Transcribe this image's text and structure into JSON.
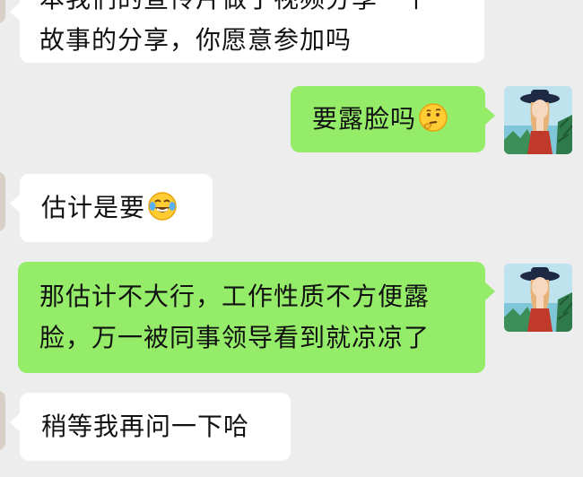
{
  "messages": [
    {
      "id": "m1",
      "direction": "incoming",
      "lines": [
        "本我们的宣传片做了视频分享一个",
        "故事的分享，你愿意参加吗"
      ]
    },
    {
      "id": "m2",
      "direction": "outgoing",
      "text": "要露脸吗",
      "emoji": "thinking-face-icon"
    },
    {
      "id": "m3",
      "direction": "incoming",
      "text": "估计是要",
      "emoji": "tears-of-joy-icon"
    },
    {
      "id": "m4",
      "direction": "outgoing",
      "lines": [
        "那估计不大行，工作性质不方便露",
        "脸，万一被同事领导看到就凉凉了"
      ]
    },
    {
      "id": "m5",
      "direction": "incoming",
      "text": "稍等我再问一下哈"
    }
  ],
  "colors": {
    "background": "#ededed",
    "incoming_bubble": "#ffffff",
    "outgoing_bubble": "#95ec69",
    "text": "#111111"
  }
}
